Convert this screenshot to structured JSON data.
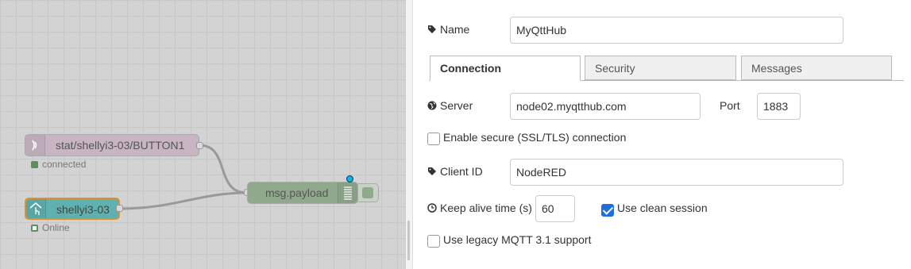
{
  "canvas": {
    "nodes": [
      {
        "label": "stat/shellyi3-03/BUTTON1",
        "status": "connected",
        "status_color": "#5a8e5a",
        "color": "#c7b5c4"
      },
      {
        "label": "shellyi3-03",
        "status": "Online",
        "status_color": "#5a8e5a",
        "color": "#5fb1b0"
      },
      {
        "label": "msg.payload",
        "color": "#90a98d"
      }
    ]
  },
  "form": {
    "name": {
      "label": "Name",
      "icon": "tag-icon",
      "value": "MyQttHub"
    },
    "tabs": [
      {
        "label": "Connection",
        "active": true
      },
      {
        "label": "Security",
        "active": false
      },
      {
        "label": "Messages",
        "active": false
      }
    ],
    "server": {
      "label": "Server",
      "icon": "globe-icon",
      "value": "node02.myqtthub.com"
    },
    "port": {
      "label": "Port",
      "value": "1883"
    },
    "tls": {
      "label": "Enable secure (SSL/TLS) connection",
      "checked": false
    },
    "client_id": {
      "label": "Client ID",
      "icon": "tag-icon",
      "value": "NodeRED"
    },
    "keepalive": {
      "label": "Keep alive time (s)",
      "icon": "clock-icon",
      "value": "60"
    },
    "clean_session": {
      "label": "Use clean session",
      "checked": true
    },
    "legacy": {
      "label": "Use legacy MQTT 3.1 support",
      "checked": false
    }
  },
  "colors": {
    "accent": "#1e6fd9",
    "selection": "#e2902c",
    "changed_indicator": "#00bcd4"
  }
}
